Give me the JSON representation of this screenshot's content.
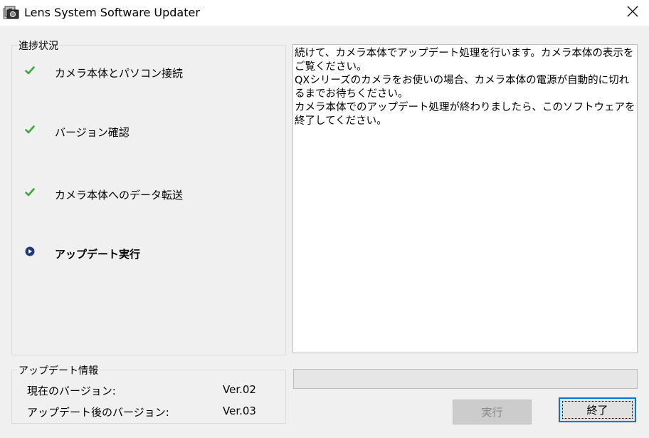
{
  "window": {
    "title": "Lens System Software Updater",
    "icon": "camera-app-icon"
  },
  "progress_group": {
    "label": "進捗状況",
    "steps": [
      {
        "label": "カメラ本体とパソコン接続",
        "state": "done"
      },
      {
        "label": "バージョン確認",
        "state": "done"
      },
      {
        "label": "カメラ本体へのデータ転送",
        "state": "done"
      },
      {
        "label": "アップデート実行",
        "state": "current"
      }
    ]
  },
  "info_group": {
    "label": "アップデート情報",
    "current_label": "現在のバージョン:",
    "current_value": "Ver.02",
    "after_label": "アップデート後のバージョン:",
    "after_value": "Ver.03"
  },
  "message": {
    "lines": [
      "続けて、カメラ本体でアップデート処理を行います。カメラ本体の表示をご覧ください。",
      "QXシリーズのカメラをお使いの場合、カメラ本体の電源が自動的に切れるまでお待ちください。",
      "カメラ本体でのアップデート処理が終わりましたら、このソフトウェアを終了してください。"
    ]
  },
  "progress_bar": {
    "value": 0
  },
  "buttons": {
    "execute": "実行",
    "quit": "終了"
  },
  "colors": {
    "check": "#3aa63a",
    "current_marker": "#1f3b73",
    "focus_border": "#0078d7"
  }
}
